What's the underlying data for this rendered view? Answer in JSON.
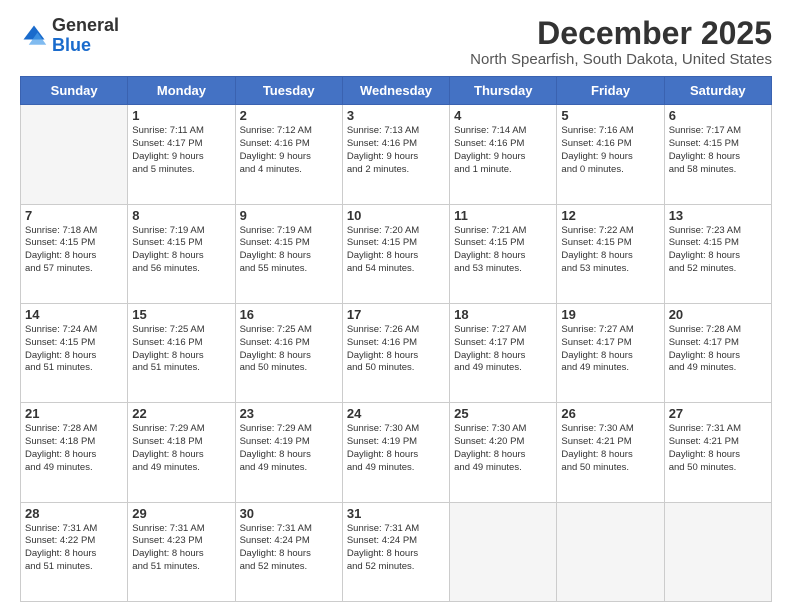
{
  "header": {
    "logo_general": "General",
    "logo_blue": "Blue",
    "month_title": "December 2025",
    "location": "North Spearfish, South Dakota, United States"
  },
  "days_of_week": [
    "Sunday",
    "Monday",
    "Tuesday",
    "Wednesday",
    "Thursday",
    "Friday",
    "Saturday"
  ],
  "weeks": [
    [
      {
        "day": "",
        "info": ""
      },
      {
        "day": "1",
        "info": "Sunrise: 7:11 AM\nSunset: 4:17 PM\nDaylight: 9 hours\nand 5 minutes."
      },
      {
        "day": "2",
        "info": "Sunrise: 7:12 AM\nSunset: 4:16 PM\nDaylight: 9 hours\nand 4 minutes."
      },
      {
        "day": "3",
        "info": "Sunrise: 7:13 AM\nSunset: 4:16 PM\nDaylight: 9 hours\nand 2 minutes."
      },
      {
        "day": "4",
        "info": "Sunrise: 7:14 AM\nSunset: 4:16 PM\nDaylight: 9 hours\nand 1 minute."
      },
      {
        "day": "5",
        "info": "Sunrise: 7:16 AM\nSunset: 4:16 PM\nDaylight: 9 hours\nand 0 minutes."
      },
      {
        "day": "6",
        "info": "Sunrise: 7:17 AM\nSunset: 4:15 PM\nDaylight: 8 hours\nand 58 minutes."
      }
    ],
    [
      {
        "day": "7",
        "info": "Sunrise: 7:18 AM\nSunset: 4:15 PM\nDaylight: 8 hours\nand 57 minutes."
      },
      {
        "day": "8",
        "info": "Sunrise: 7:19 AM\nSunset: 4:15 PM\nDaylight: 8 hours\nand 56 minutes."
      },
      {
        "day": "9",
        "info": "Sunrise: 7:19 AM\nSunset: 4:15 PM\nDaylight: 8 hours\nand 55 minutes."
      },
      {
        "day": "10",
        "info": "Sunrise: 7:20 AM\nSunset: 4:15 PM\nDaylight: 8 hours\nand 54 minutes."
      },
      {
        "day": "11",
        "info": "Sunrise: 7:21 AM\nSunset: 4:15 PM\nDaylight: 8 hours\nand 53 minutes."
      },
      {
        "day": "12",
        "info": "Sunrise: 7:22 AM\nSunset: 4:15 PM\nDaylight: 8 hours\nand 53 minutes."
      },
      {
        "day": "13",
        "info": "Sunrise: 7:23 AM\nSunset: 4:15 PM\nDaylight: 8 hours\nand 52 minutes."
      }
    ],
    [
      {
        "day": "14",
        "info": "Sunrise: 7:24 AM\nSunset: 4:15 PM\nDaylight: 8 hours\nand 51 minutes."
      },
      {
        "day": "15",
        "info": "Sunrise: 7:25 AM\nSunset: 4:16 PM\nDaylight: 8 hours\nand 51 minutes."
      },
      {
        "day": "16",
        "info": "Sunrise: 7:25 AM\nSunset: 4:16 PM\nDaylight: 8 hours\nand 50 minutes."
      },
      {
        "day": "17",
        "info": "Sunrise: 7:26 AM\nSunset: 4:16 PM\nDaylight: 8 hours\nand 50 minutes."
      },
      {
        "day": "18",
        "info": "Sunrise: 7:27 AM\nSunset: 4:17 PM\nDaylight: 8 hours\nand 49 minutes."
      },
      {
        "day": "19",
        "info": "Sunrise: 7:27 AM\nSunset: 4:17 PM\nDaylight: 8 hours\nand 49 minutes."
      },
      {
        "day": "20",
        "info": "Sunrise: 7:28 AM\nSunset: 4:17 PM\nDaylight: 8 hours\nand 49 minutes."
      }
    ],
    [
      {
        "day": "21",
        "info": "Sunrise: 7:28 AM\nSunset: 4:18 PM\nDaylight: 8 hours\nand 49 minutes."
      },
      {
        "day": "22",
        "info": "Sunrise: 7:29 AM\nSunset: 4:18 PM\nDaylight: 8 hours\nand 49 minutes."
      },
      {
        "day": "23",
        "info": "Sunrise: 7:29 AM\nSunset: 4:19 PM\nDaylight: 8 hours\nand 49 minutes."
      },
      {
        "day": "24",
        "info": "Sunrise: 7:30 AM\nSunset: 4:19 PM\nDaylight: 8 hours\nand 49 minutes."
      },
      {
        "day": "25",
        "info": "Sunrise: 7:30 AM\nSunset: 4:20 PM\nDaylight: 8 hours\nand 49 minutes."
      },
      {
        "day": "26",
        "info": "Sunrise: 7:30 AM\nSunset: 4:21 PM\nDaylight: 8 hours\nand 50 minutes."
      },
      {
        "day": "27",
        "info": "Sunrise: 7:31 AM\nSunset: 4:21 PM\nDaylight: 8 hours\nand 50 minutes."
      }
    ],
    [
      {
        "day": "28",
        "info": "Sunrise: 7:31 AM\nSunset: 4:22 PM\nDaylight: 8 hours\nand 51 minutes."
      },
      {
        "day": "29",
        "info": "Sunrise: 7:31 AM\nSunset: 4:23 PM\nDaylight: 8 hours\nand 51 minutes."
      },
      {
        "day": "30",
        "info": "Sunrise: 7:31 AM\nSunset: 4:24 PM\nDaylight: 8 hours\nand 52 minutes."
      },
      {
        "day": "31",
        "info": "Sunrise: 7:31 AM\nSunset: 4:24 PM\nDaylight: 8 hours\nand 52 minutes."
      },
      {
        "day": "",
        "info": ""
      },
      {
        "day": "",
        "info": ""
      },
      {
        "day": "",
        "info": ""
      }
    ]
  ]
}
